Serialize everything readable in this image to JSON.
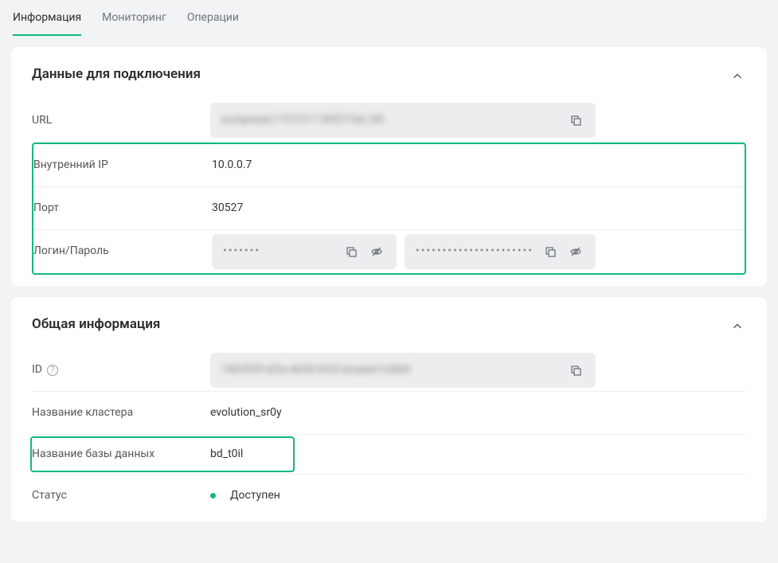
{
  "tabs": {
    "info": "Информация",
    "monitoring": "Мониторинг",
    "operations": "Операции"
  },
  "connection": {
    "title": "Данные для подключения",
    "url_label": "URL",
    "url_value": "postgresql://10.0.0.7:30527/bd_t0il",
    "internal_ip_label": "Внутренний IP",
    "internal_ip_value": "10.0.0.7",
    "port_label": "Порт",
    "port_value": "30527",
    "login_label": "Логин/Пароль",
    "login_value": "•••••••",
    "password_value": "•••••••••••••••••••••••••••••••••..."
  },
  "general": {
    "title": "Общая информация",
    "id_label": "ID",
    "id_value": "74639f3f-af2a-4628-9333-dcaeeb7c3844",
    "cluster_label": "Название кластера",
    "cluster_value": "evolution_sr0y",
    "db_label": "Название базы данных",
    "db_value": "bd_t0il",
    "status_label": "Статус",
    "status_value": "Доступен"
  },
  "icons": {
    "help": "?"
  }
}
